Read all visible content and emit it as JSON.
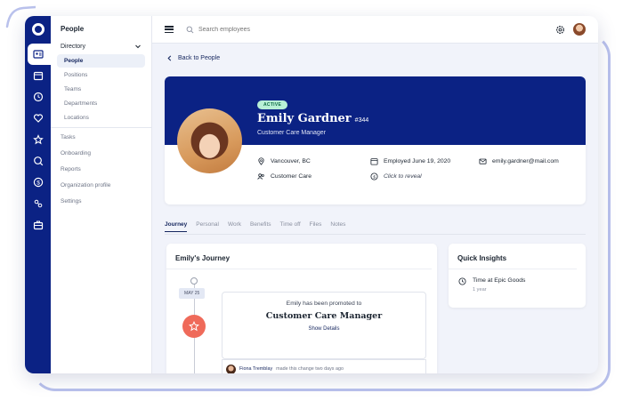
{
  "sidebar": {
    "section_title": "People",
    "directory_label": "Directory",
    "directory_items": [
      {
        "label": "People"
      },
      {
        "label": "Positions"
      },
      {
        "label": "Teams"
      },
      {
        "label": "Departments"
      },
      {
        "label": "Locations"
      }
    ],
    "other_items": [
      {
        "label": "Tasks"
      },
      {
        "label": "Onboarding"
      },
      {
        "label": "Reports"
      },
      {
        "label": "Organization profile"
      },
      {
        "label": "Settings"
      }
    ]
  },
  "topbar": {
    "search_placeholder": "Search employees"
  },
  "back_link": "Back to People",
  "profile": {
    "status_badge": "ACTIVE",
    "name": "Emily Gardner",
    "employee_id": "#344",
    "job_title": "Customer Care Manager",
    "location": "Vancouver, BC",
    "department": "Customer Care",
    "employed": "Employed June 19, 2020",
    "salary": "Click to reveal",
    "email": "emily.gardner@mail.com"
  },
  "tabs": [
    {
      "label": "Journey"
    },
    {
      "label": "Personal"
    },
    {
      "label": "Work"
    },
    {
      "label": "Benefits"
    },
    {
      "label": "Time off"
    },
    {
      "label": "Files"
    },
    {
      "label": "Notes"
    }
  ],
  "journey": {
    "title": "Emily's Journey",
    "date": "MAY 25",
    "event_intro": "Emily has been promoted to",
    "event_title": "Customer Care Manager",
    "details_link": "Show Details",
    "actor": "Fiona Tremblay",
    "actor_suffix": "made this change two days ago"
  },
  "insights": {
    "title": "Quick Insights",
    "item_label": "Time at Epic Goods",
    "item_value": "1 year"
  },
  "colors": {
    "brand_navy": "#0b2284",
    "active_badge_bg": "#b8f0d6",
    "promotion_accent": "#ef6a5a"
  }
}
